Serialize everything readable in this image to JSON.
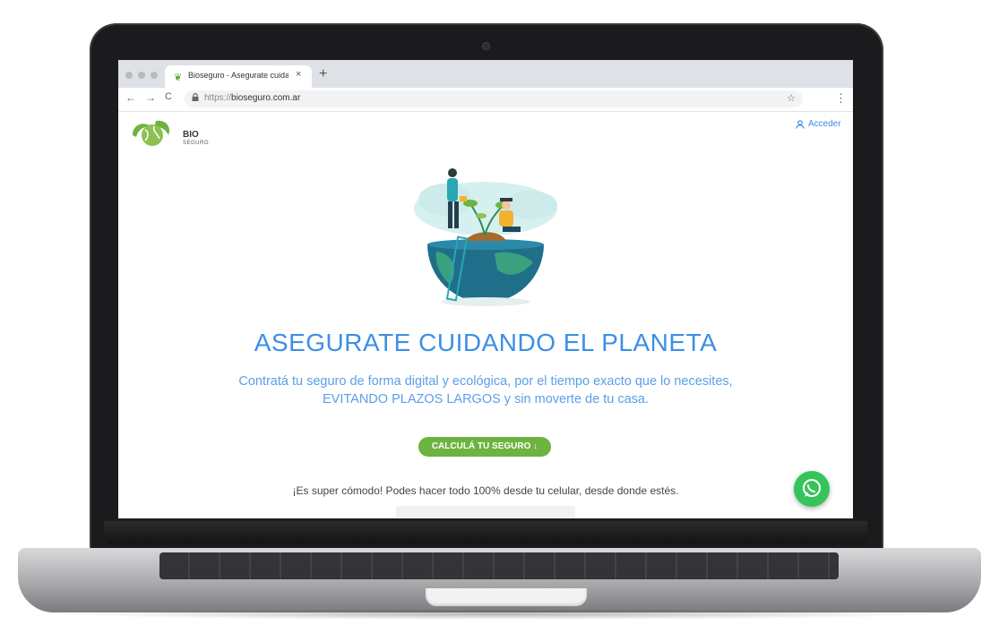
{
  "browser": {
    "tab_title": "Bioseguro - Asegurate cuidando el planeta",
    "new_tab": "+",
    "tab_close": "×",
    "url_protocol": "https://",
    "url_host": "bioseguro.com.ar",
    "back": "←",
    "forward": "→",
    "reload": "C",
    "star": "☆",
    "menu": "⋮",
    "lock": "🔒"
  },
  "header": {
    "logo_line1": "BIO",
    "logo_line2": "SEGURO",
    "login_label": "Acceder"
  },
  "hero": {
    "headline": "ASEGURATE CUIDANDO EL PLANETA",
    "subtitle_line1": "Contratá tu seguro de forma digital y ecológica, por el tiempo exacto que lo necesites,",
    "subtitle_line2": "EVITANDO PLAZOS LARGOS y sin moverte de tu casa.",
    "cta_label": "CALCULÁ TU SEGURO ↓",
    "comfort_text": "¡Es super cómodo! Podes hacer todo 100% desde tu celular, desde donde estés."
  },
  "colors": {
    "brand_green": "#6cb33f",
    "accent_blue": "#3c8fe6",
    "whatsapp_green": "#35c45a"
  },
  "icons": [
    "leaf-favicon-icon",
    "lock-icon",
    "star-icon",
    "menu-icon",
    "user-icon",
    "whatsapp-icon"
  ]
}
